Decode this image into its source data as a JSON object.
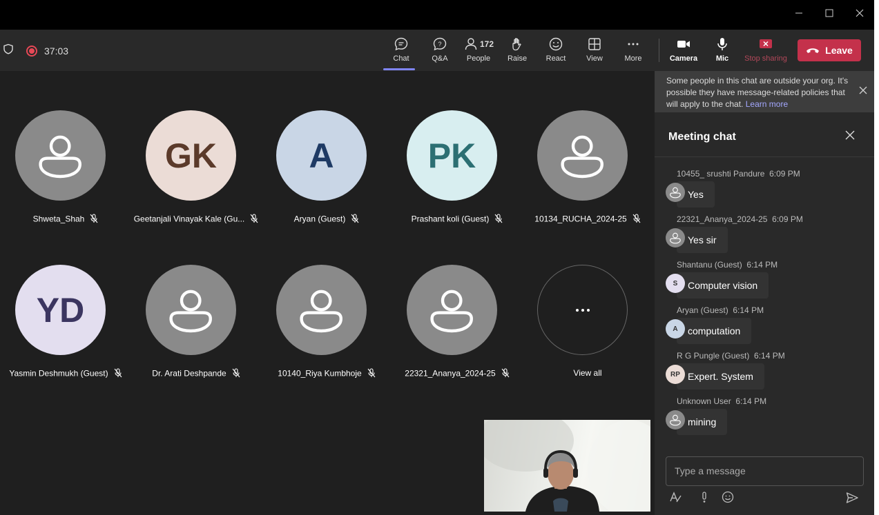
{
  "window": {
    "controls": [
      "minimize-icon",
      "maximize-icon",
      "close-icon"
    ]
  },
  "toolbar": {
    "timer": "37:03",
    "buttons": {
      "chat": "Chat",
      "qa": "Q&A",
      "people": "People",
      "people_count": "172",
      "raise": "Raise",
      "react": "React",
      "view": "View",
      "more": "More",
      "camera": "Camera",
      "mic": "Mic",
      "stop_sharing": "Stop sharing",
      "leave": "Leave"
    }
  },
  "participants": [
    {
      "name": "Shweta_Shah",
      "initials": "",
      "avatar_color": "#8a8a8a",
      "text_color": "#ffffff"
    },
    {
      "name": "Geetanjali Vinayak Kale (Gu...",
      "initials": "GK",
      "avatar_color": "#ebdcd6",
      "text_color": "#5b3a2a"
    },
    {
      "name": "Aryan (Guest)",
      "initials": "A",
      "avatar_color": "#c9d6e6",
      "text_color": "#1e3a64"
    },
    {
      "name": "Prashant koli (Guest)",
      "initials": "PK",
      "avatar_color": "#d8eef0",
      "text_color": "#2c6f73"
    },
    {
      "name": "10134_RUCHA_2024-25",
      "initials": "",
      "avatar_color": "#8a8a8a",
      "text_color": "#ffffff"
    },
    {
      "name": "Yasmin Deshmukh (Guest)",
      "initials": "YD",
      "avatar_color": "#e3deef",
      "text_color": "#3b3560"
    },
    {
      "name": "Dr. Arati Deshpande",
      "initials": "",
      "avatar_color": "#8a8a8a",
      "text_color": "#ffffff"
    },
    {
      "name": "10140_Riya Kumbhoje",
      "initials": "",
      "avatar_color": "#8a8a8a",
      "text_color": "#ffffff"
    },
    {
      "name": "22321_Ananya_2024-25",
      "initials": "",
      "avatar_color": "#8a8a8a",
      "text_color": "#ffffff"
    }
  ],
  "view_all": "View all",
  "chat_panel": {
    "banner_text": "Some people in this chat are outside your org. It's possible they have message-related policies that will apply to the chat.",
    "banner_link": "Learn more",
    "title": "Meeting chat",
    "messages": [
      {
        "sender": "10455_ srushti Pandure",
        "time": "6:09 PM",
        "text": "Yes",
        "initials": "",
        "avatar_color": "#8a8a8a"
      },
      {
        "sender": "22321_Ananya_2024-25",
        "time": "6:09 PM",
        "text": "Yes sir",
        "initials": "",
        "avatar_color": "#8a8a8a"
      },
      {
        "sender": "Shantanu (Guest)",
        "time": "6:14 PM",
        "text": "Computer vision",
        "initials": "S",
        "avatar_color": "#e3deef"
      },
      {
        "sender": "Aryan (Guest)",
        "time": "6:14 PM",
        "text": "computation",
        "initials": "A",
        "avatar_color": "#c9d6e6"
      },
      {
        "sender": "R G Pungle (Guest)",
        "time": "6:14 PM",
        "text": "Expert. System",
        "initials": "RP",
        "avatar_color": "#ebdcd6"
      },
      {
        "sender": "Unknown User",
        "time": "6:14 PM",
        "text": "mining",
        "initials": "",
        "avatar_color": "#8a8a8a"
      }
    ],
    "compose_placeholder": "Type a message"
  },
  "colors": {
    "accent": "#7f85f5",
    "leave": "#c4314b",
    "recording": "#e74856"
  }
}
